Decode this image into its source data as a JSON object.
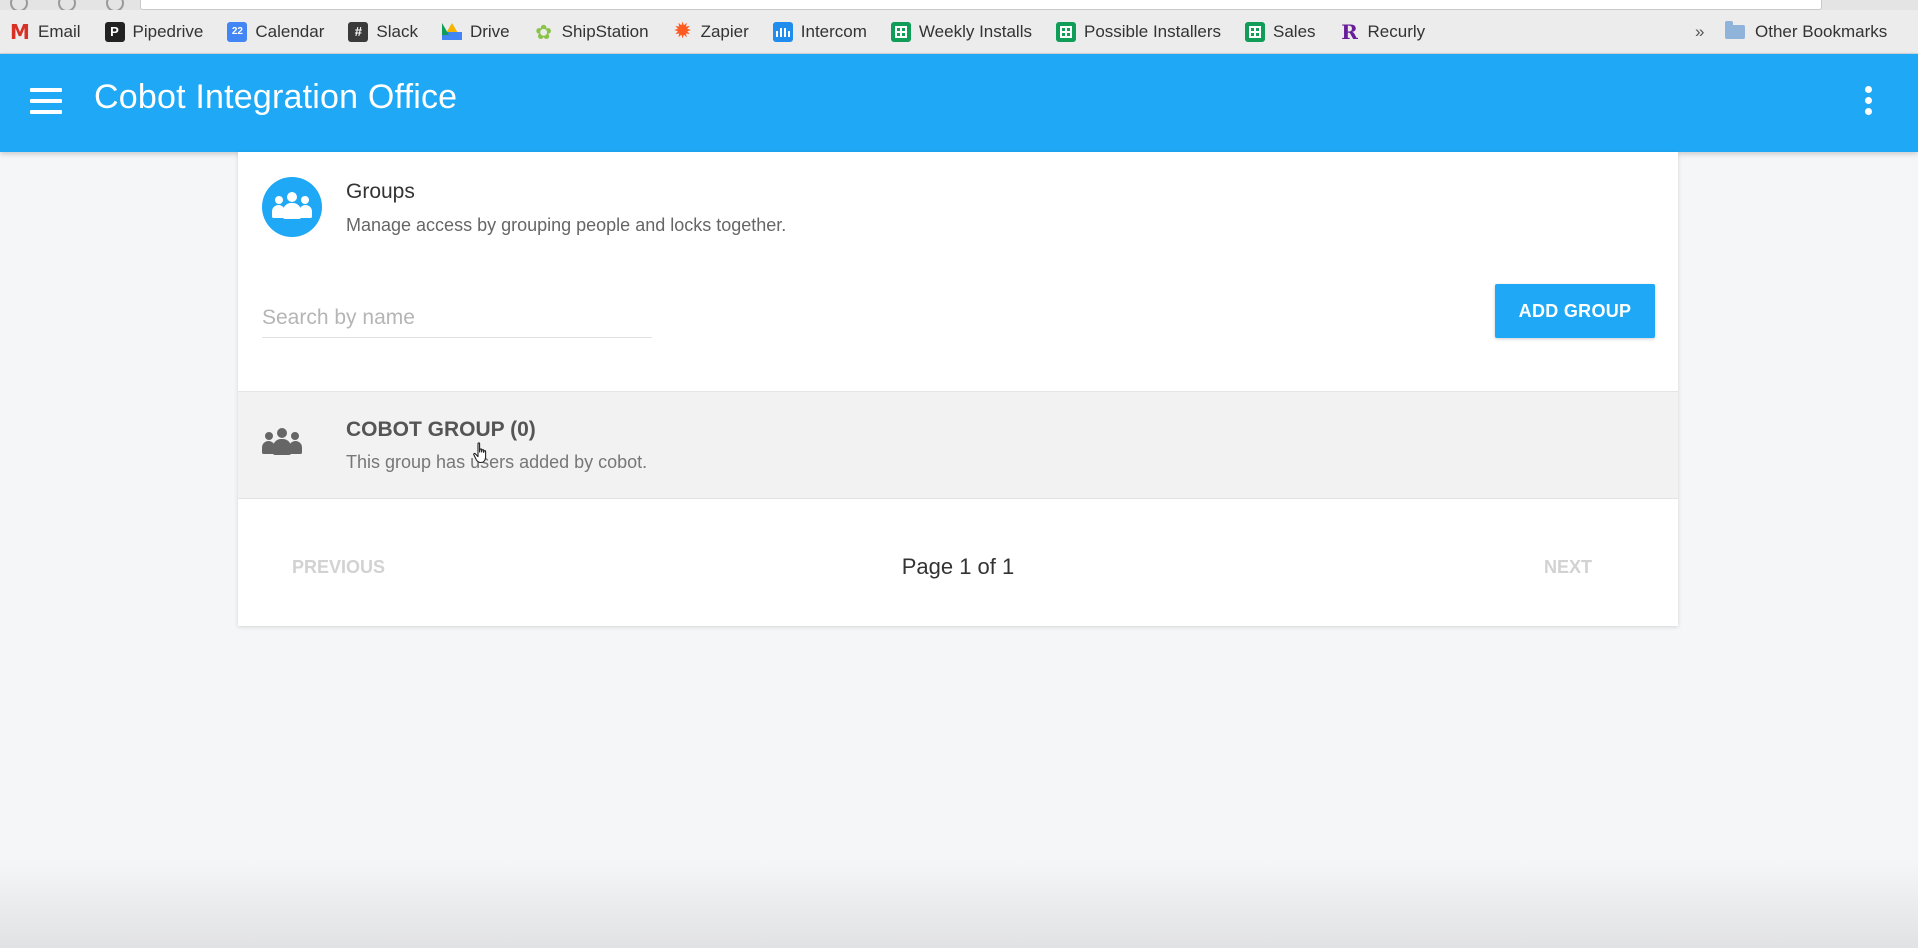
{
  "bookmarks": {
    "items": [
      {
        "label": "Email",
        "icon": "gmail-icon",
        "glyph": "M"
      },
      {
        "label": "Pipedrive",
        "icon": "pipedrive-icon",
        "glyph": "P"
      },
      {
        "label": "Calendar",
        "icon": "calendar-icon",
        "glyph": "22"
      },
      {
        "label": "Slack",
        "icon": "slack-icon",
        "glyph": "#"
      },
      {
        "label": "Drive",
        "icon": "drive-icon"
      },
      {
        "label": "ShipStation",
        "icon": "shipstation-icon",
        "glyph": "✿"
      },
      {
        "label": "Zapier",
        "icon": "zapier-icon",
        "glyph": "✹"
      },
      {
        "label": "Intercom",
        "icon": "intercom-icon"
      },
      {
        "label": "Weekly Installs",
        "icon": "sheets-icon"
      },
      {
        "label": "Possible Installers",
        "icon": "sheets-icon"
      },
      {
        "label": "Sales",
        "icon": "sheets-icon"
      },
      {
        "label": "Recurly",
        "icon": "recurly-icon",
        "glyph": "R"
      }
    ],
    "overflow": "»",
    "other": "Other Bookmarks"
  },
  "header": {
    "title": "Cobot Integration Office"
  },
  "groups_section": {
    "title": "Groups",
    "subtitle": "Manage access by grouping people and locks together.",
    "search_placeholder": "Search by name",
    "search_value": "",
    "add_button": "ADD GROUP"
  },
  "groups": [
    {
      "name": "COBOT GROUP (0)",
      "description": "This group has users added by cobot."
    }
  ],
  "pagination": {
    "previous": "PREVIOUS",
    "page_text": "Page 1 of 1",
    "next": "NEXT"
  },
  "colors": {
    "accent": "#1ea8f5",
    "row_bg": "#f2f2f2",
    "page_bg": "#f5f6f8"
  }
}
